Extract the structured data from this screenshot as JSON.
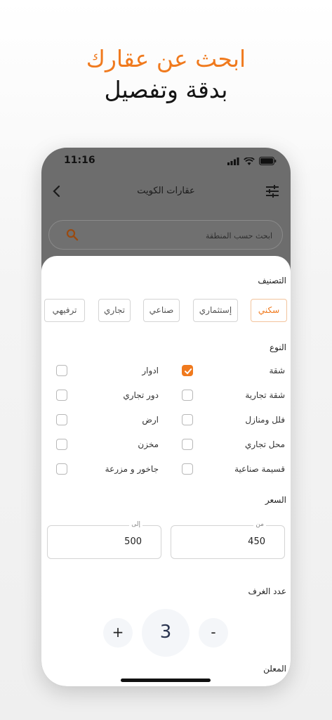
{
  "promo": {
    "line1": "ابحث عن عقارك",
    "line2": "بدقة وتفصيل",
    "accent_color": "#f07a1e"
  },
  "status_bar": {
    "time": "11:16",
    "icons": [
      "signal-icon",
      "wifi-icon",
      "battery-icon"
    ]
  },
  "app_bar": {
    "title": "عقارات الكويت",
    "back_icon": "chevron-left-icon",
    "filter_icon": "sliders-icon"
  },
  "search": {
    "placeholder": "ابحث حسب المنطقة",
    "value": ""
  },
  "filters": {
    "category": {
      "title": "التصنيف",
      "options": [
        "سكني",
        "إستثماري",
        "صناعي",
        "تجاري",
        "ترفيهي"
      ],
      "selected": "سكني"
    },
    "type": {
      "title": "النوع",
      "options": [
        {
          "label": "شقة",
          "checked": true
        },
        {
          "label": "ادوار",
          "checked": false
        },
        {
          "label": "شقة تجارية",
          "checked": false
        },
        {
          "label": "دور تجاري",
          "checked": false
        },
        {
          "label": "فلل ومنازل",
          "checked": false
        },
        {
          "label": "ارض",
          "checked": false
        },
        {
          "label": "محل تجاري",
          "checked": false
        },
        {
          "label": "مخزن",
          "checked": false
        },
        {
          "label": "قسيمة صناعية",
          "checked": false
        },
        {
          "label": "جاخور و مزرعة",
          "checked": false
        }
      ]
    },
    "price": {
      "title": "السعر",
      "from_label": "من",
      "from_value": "450",
      "to_label": "إلى",
      "to_value": "500"
    },
    "rooms": {
      "title": "عدد الغرف",
      "value": "3",
      "minus_label": "-",
      "plus_label": "+"
    },
    "advertiser": {
      "title": "المعلن"
    }
  }
}
